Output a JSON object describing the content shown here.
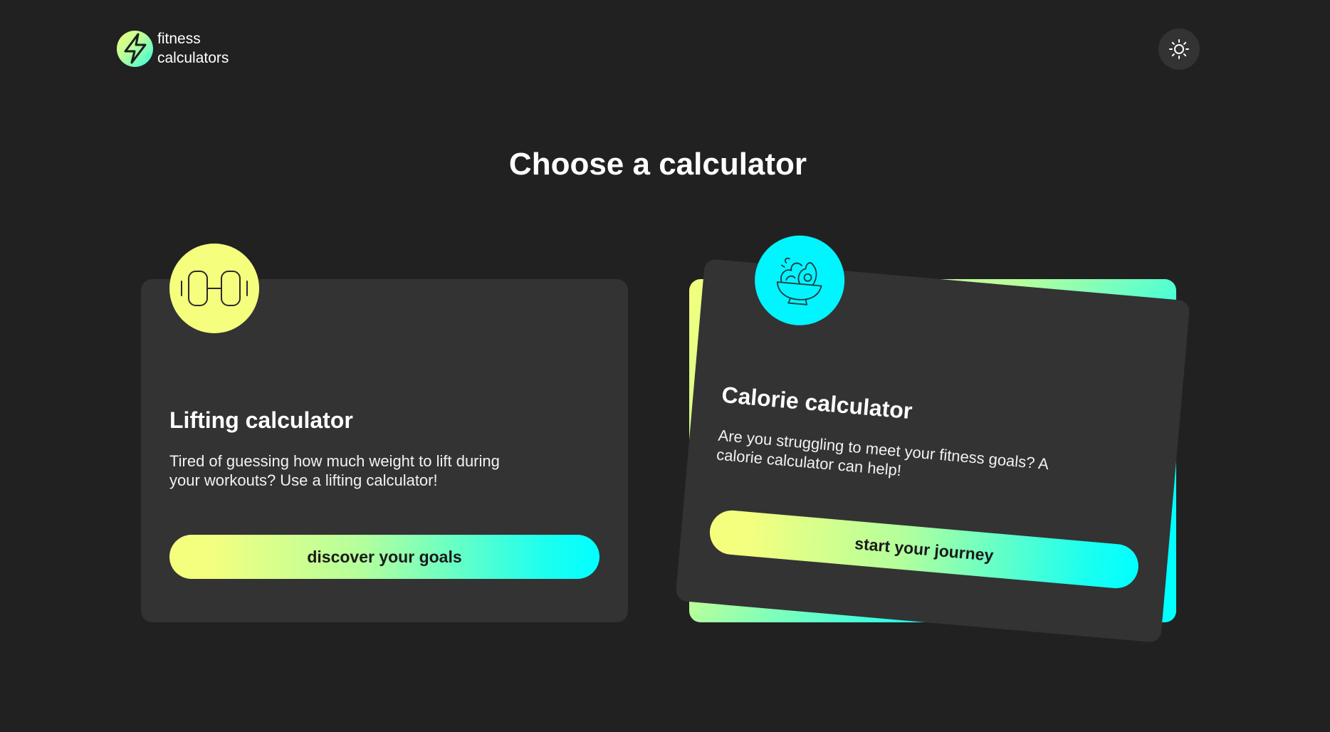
{
  "header": {
    "logo_line1": "fitness",
    "logo_line2": "calculators",
    "logo_icon": "lightning-bolt-icon",
    "theme_toggle_icon": "sun-icon"
  },
  "main": {
    "title": "Choose a calculator"
  },
  "cards": [
    {
      "icon": "dumbbell-icon",
      "title": "Lifting calculator",
      "description": "Tired of guessing how much weight to lift during your workouts? Use a lifting calculator!",
      "button_label": "discover your goals",
      "icon_color": "#f5ff7d"
    },
    {
      "icon": "salad-bowl-icon",
      "title": "Calorie calculator",
      "description": "Are you struggling to meet your fitness goals? A calorie calculator can help!",
      "button_label": "start your journey",
      "icon_color": "#00f5ff"
    }
  ],
  "colors": {
    "background": "#212121",
    "card": "#333333",
    "accent_yellow": "#f5ff7d",
    "accent_cyan": "#00ffff"
  }
}
